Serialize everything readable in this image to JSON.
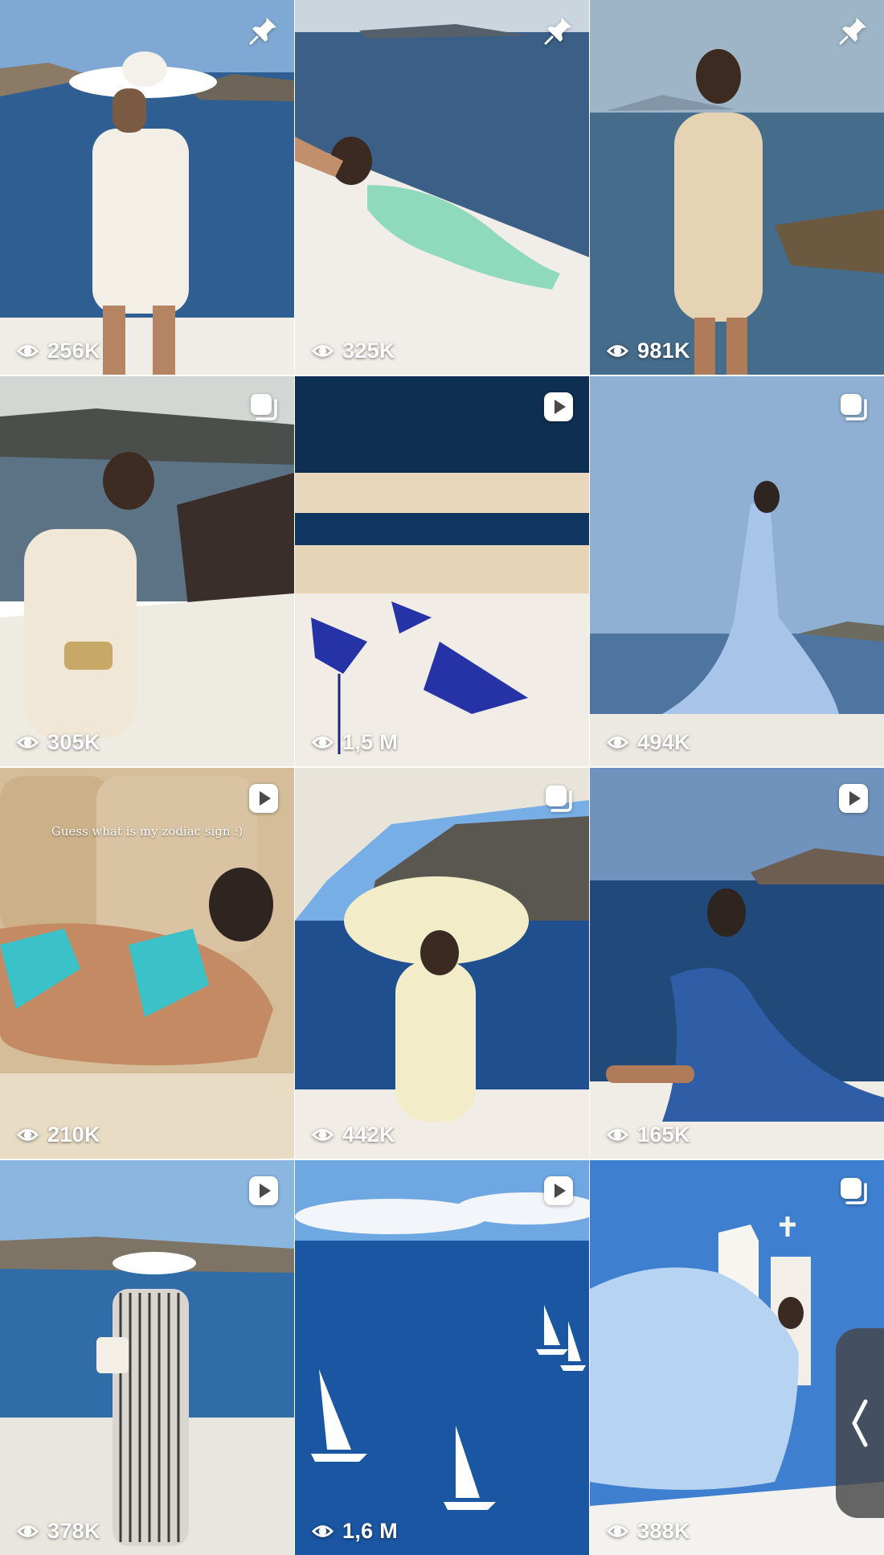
{
  "grid": {
    "posts": [
      {
        "views": "256K",
        "badge": "pin-icon",
        "scene": "woman in white sun hat and white dress on terrace above sea",
        "colors": {
          "sky": "#7aa6d2",
          "sea": "#2f5f92",
          "accent": "#f3efe6"
        }
      },
      {
        "views": "325K",
        "badge": "pin-icon",
        "scene": "woman in mint dress lying on white wall above sea",
        "colors": {
          "sky": "#c9d4dd",
          "sea": "#3b5f86",
          "accent": "#8fd9bd"
        }
      },
      {
        "views": "981K",
        "badge": "pin-icon",
        "scene": "woman in sequined beige dress by rocky seashore",
        "colors": {
          "sky": "#9ab3c6",
          "sea": "#456c8b",
          "accent": "#e6d3b4"
        }
      },
      {
        "views": "305K",
        "badge": "carousel-icon",
        "scene": "smiling woman in lace dress on cliff terrace",
        "colors": {
          "sky": "#cfd4d3",
          "sea": "#596f82",
          "accent": "#f1e7d6"
        }
      },
      {
        "views": "1,5 M",
        "badge": "reel-icon",
        "scene": "blue bikini laid on white ledge",
        "colors": {
          "sky": "#0f2f52",
          "sea": "#1d4e7e",
          "accent": "#2633a6"
        }
      },
      {
        "views": "494K",
        "badge": "carousel-icon",
        "scene": "woman in light blue gown facing the sea",
        "colors": {
          "sky": "#8fb0d2",
          "sea": "#4d75a0",
          "accent": "#a8c4e8"
        }
      },
      {
        "views": "210K",
        "badge": "reel-icon",
        "caption": "Guess what is my zodiac sign :)",
        "scene": "woman in turquoise bikini lying on beige cushions",
        "colors": {
          "sky": "#d9c3a2",
          "sea": "#c8ad87",
          "accent": "#3bc2c8"
        }
      },
      {
        "views": "442K",
        "badge": "carousel-icon",
        "scene": "woman in big straw hat and cream swimsuit on yacht",
        "colors": {
          "sky": "#78aee6",
          "sea": "#1f4f8f",
          "accent": "#f2ecc9"
        }
      },
      {
        "views": "165K",
        "badge": "reel-icon",
        "scene": "woman in blue sequined gown sitting on ledge",
        "colors": {
          "sky": "#6f93bd",
          "sea": "#21497a",
          "accent": "#2f5da6"
        }
      },
      {
        "views": "378K",
        "badge": "reel-icon",
        "scene": "woman in striped jumpsuit and white hat on terrace",
        "colors": {
          "sky": "#8bb6e0",
          "sea": "#2f6ca8",
          "accent": "#e9e6df"
        }
      },
      {
        "views": "1,6 M",
        "badge": "reel-icon",
        "scene": "white sailboats on deep blue sea",
        "colors": {
          "sky": "#6fa7e2",
          "sea": "#1b56a3",
          "accent": "#ffffff"
        }
      },
      {
        "views": "388K",
        "badge": "carousel-icon",
        "scene": "woman with flowing light blue fabric by white chapel",
        "colors": {
          "sky": "#3f7fd0",
          "sea": "#2d6cc2",
          "accent": "#b6d3f2"
        }
      }
    ]
  }
}
